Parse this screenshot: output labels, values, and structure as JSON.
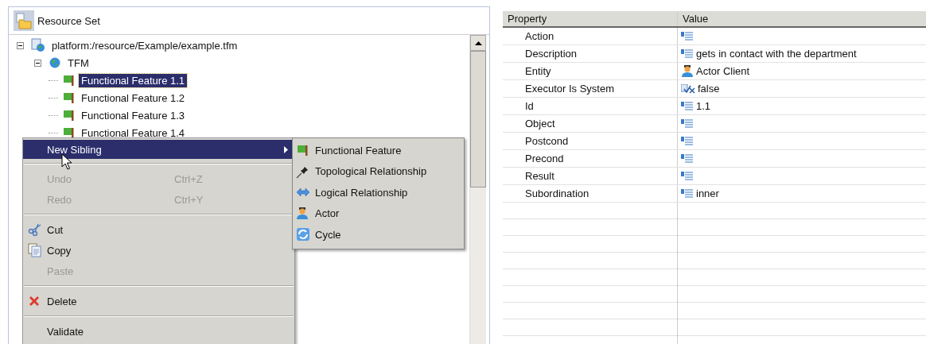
{
  "resource_panel": {
    "title": "Resource Set"
  },
  "tree": [
    {
      "label": "platform:/resource/Example/example.tfm",
      "kind": "resource",
      "expanded": true,
      "selected": false,
      "children": [
        {
          "label": "TFM",
          "kind": "model",
          "expanded": true,
          "selected": false,
          "children": [
            {
              "label": "Functional Feature 1.1",
              "kind": "feature",
              "selected": true
            },
            {
              "label": "Functional Feature 1.2",
              "kind": "feature",
              "selected": false
            },
            {
              "label": "Functional Feature 1.3",
              "kind": "feature",
              "selected": false
            },
            {
              "label": "Functional Feature 1.4",
              "kind": "feature",
              "selected": false
            }
          ]
        }
      ]
    }
  ],
  "context_menu": {
    "items": [
      {
        "kind": "submenu",
        "label": "New Sibling",
        "selected": true,
        "disabled": false
      },
      {
        "kind": "separator"
      },
      {
        "kind": "item",
        "label": "Undo",
        "shortcut": "Ctrl+Z",
        "selected": false,
        "disabled": true
      },
      {
        "kind": "item",
        "label": "Redo",
        "shortcut": "Ctrl+Y",
        "selected": false,
        "disabled": true
      },
      {
        "kind": "separator"
      },
      {
        "kind": "cut",
        "label": "Cut",
        "selected": false,
        "disabled": false
      },
      {
        "kind": "copy",
        "label": "Copy",
        "selected": false,
        "disabled": false
      },
      {
        "kind": "item",
        "label": "Paste",
        "selected": false,
        "disabled": true
      },
      {
        "kind": "separator"
      },
      {
        "kind": "delete",
        "label": "Delete",
        "selected": false,
        "disabled": false
      },
      {
        "kind": "separator"
      },
      {
        "kind": "item",
        "label": "Validate",
        "selected": false,
        "disabled": false
      }
    ]
  },
  "submenu": {
    "items": [
      {
        "label": "Functional Feature",
        "kind": "feature"
      },
      {
        "label": "Topological Relationship",
        "kind": "pin"
      },
      {
        "label": "Logical Relationship",
        "kind": "arrows"
      },
      {
        "label": "Actor",
        "kind": "actor"
      },
      {
        "label": "Cycle",
        "kind": "cycle"
      }
    ]
  },
  "properties": {
    "columns": [
      "Property",
      "Value"
    ],
    "rows": [
      {
        "property": "Action",
        "kind": "text"
      },
      {
        "property": "Description",
        "value": "gets in contact with the department",
        "kind": "text"
      },
      {
        "property": "Entity",
        "value": "Actor Client",
        "kind": "actor"
      },
      {
        "property": "Executor Is System",
        "value": "false",
        "kind": "boolean"
      },
      {
        "property": "Id",
        "value": "1.1",
        "kind": "text"
      },
      {
        "property": "Object",
        "kind": "text"
      },
      {
        "property": "Postcond",
        "kind": "text"
      },
      {
        "property": "Precond",
        "kind": "text"
      },
      {
        "property": "Result",
        "kind": "text"
      },
      {
        "property": "Subordination",
        "value": "inner",
        "kind": "text"
      }
    ]
  }
}
